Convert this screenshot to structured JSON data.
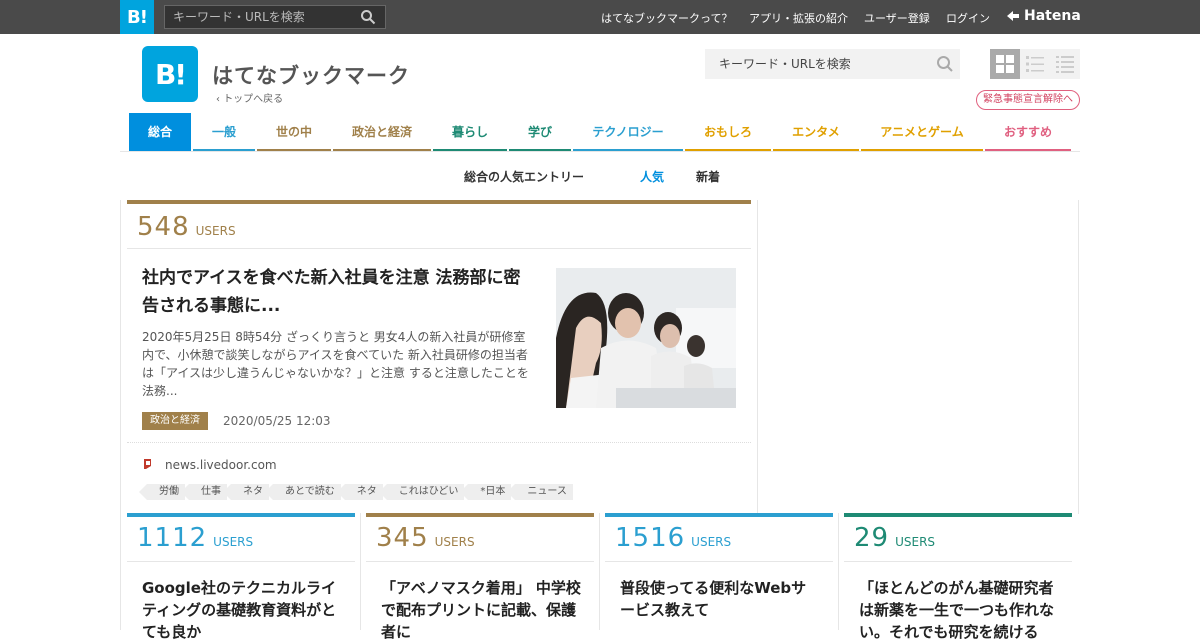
{
  "topbar": {
    "logo": "B!",
    "search_placeholder": "キーワード・URLを検索",
    "links": [
      "はてなブックマークって？",
      "アプリ・拡張の紹介",
      "ユーザー登録",
      "ログイン"
    ],
    "hatena": "Hatena"
  },
  "header": {
    "logo": "B!",
    "title": "はてなブックマーク",
    "back": "トップへ戻る",
    "search_placeholder": "キーワード・URLを検索",
    "emergency": "緊急事態宣言解除へ"
  },
  "categories": [
    {
      "label": "総合",
      "color": "#008fde",
      "active": true
    },
    {
      "label": "一般",
      "color": "#2b9fd0"
    },
    {
      "label": "世の中",
      "color": "#a0804a"
    },
    {
      "label": "政治と経済",
      "color": "#a0804a"
    },
    {
      "label": "暮らし",
      "color": "#1e8a74"
    },
    {
      "label": "学び",
      "color": "#1e8a74"
    },
    {
      "label": "テクノロジー",
      "color": "#2b9fd0"
    },
    {
      "label": "おもしろ",
      "color": "#e0a000"
    },
    {
      "label": "エンタメ",
      "color": "#e0a000"
    },
    {
      "label": "アニメとゲーム",
      "color": "#e0a000"
    },
    {
      "label": "おすすめ",
      "color": "#e06080"
    }
  ],
  "subnav": {
    "title": "総合の人気エントリー",
    "popular": "人気",
    "new": "新着"
  },
  "main_entry": {
    "users": "548",
    "users_label": "USERS",
    "title": "社内でアイスを食べた新入社員を注意 法務部に密告される事態に...",
    "description": "2020年5月25日 8時54分 ざっくり言うと 男女4人の新入社員が研修室内で、小休憩で談笑しながらアイスを食べていた 新入社員研修の担当者は「アイスは少し違うんじゃないかな？」と注意 すると注意したことを法務...",
    "category": "政治と経済",
    "date": "2020/05/25 12:03",
    "domain": "news.livedoor.com",
    "tags": [
      "労働",
      "仕事",
      "ネタ",
      "あとで読む",
      "ネタ",
      "これはひどい",
      "*日本",
      "ニュース"
    ]
  },
  "cards": [
    {
      "users": "1112",
      "users_label": "USERS",
      "title": "Google社のテクニカルライティングの基礎教育資料がとても良か",
      "color": "#2b9fd0"
    },
    {
      "users": "345",
      "users_label": "USERS",
      "title": "「アベノマスク着用」 中学校で配布プリントに記載、保護者に",
      "color": "#a0804a"
    },
    {
      "users": "1516",
      "users_label": "USERS",
      "title": "普段使ってる便利なWebサービス教えて",
      "color": "#2b9fd0"
    },
    {
      "users": "29",
      "users_label": "USERS",
      "title": "「ほとんどのがん基礎研究者は新薬を一生で一つも作れない。それでも研究を続ける",
      "color": "#1e8a74"
    }
  ]
}
